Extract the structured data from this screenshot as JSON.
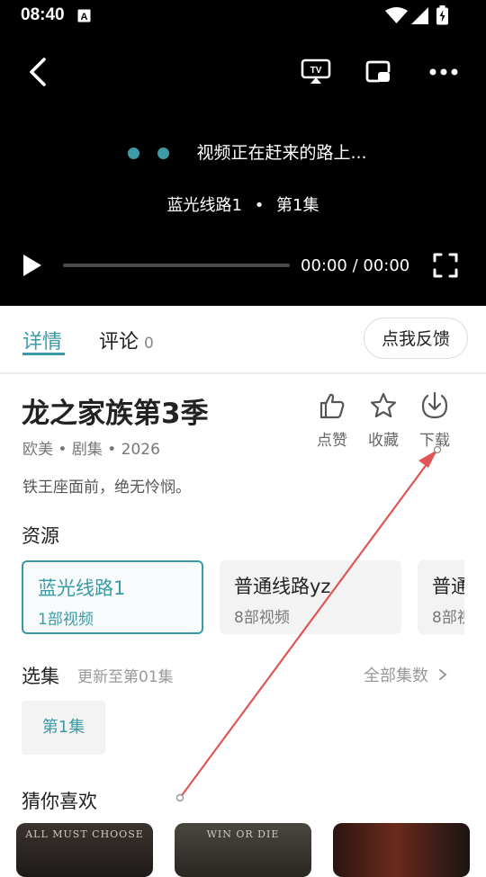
{
  "status_bar": {
    "time": "08:40"
  },
  "player": {
    "loading_text": "视频正在赶来的路上...",
    "route_line": "蓝光线路1",
    "separator": "•",
    "episode": "第1集",
    "timecode": "00:00 / 00:00"
  },
  "tabs": [
    {
      "label": "详情"
    },
    {
      "label": "评论",
      "count": "0"
    }
  ],
  "feedback_label": "点我反馈",
  "show": {
    "title": "龙之家族第3季",
    "meta": "欧美 • 剧集 • 2026",
    "description": "铁王座面前，绝无怜悯。"
  },
  "actions": [
    {
      "label": "点赞",
      "icon": "thumb-up-icon"
    },
    {
      "label": "收藏",
      "icon": "star-icon"
    },
    {
      "label": "下载",
      "icon": "download-icon"
    }
  ],
  "sources": {
    "title": "资源",
    "items": [
      {
        "name": "蓝光线路1",
        "count": "1部视频"
      },
      {
        "name": "普通线路yz",
        "count": "8部视频"
      },
      {
        "name": "普通",
        "count": "8部视"
      }
    ]
  },
  "episodes": {
    "title": "选集",
    "updated": "更新至第01集",
    "all_label": "全部集数",
    "items": [
      {
        "label": "第1集"
      }
    ]
  },
  "recommend": {
    "title": "猜你喜欢",
    "posters": [
      {
        "text": "ALL MUST CHOOSE"
      },
      {
        "text": "WIN OR DIE"
      },
      {
        "text": ""
      }
    ]
  },
  "colors": {
    "accent": "#3a9ba6",
    "annotation_arrow": "#e05555"
  }
}
